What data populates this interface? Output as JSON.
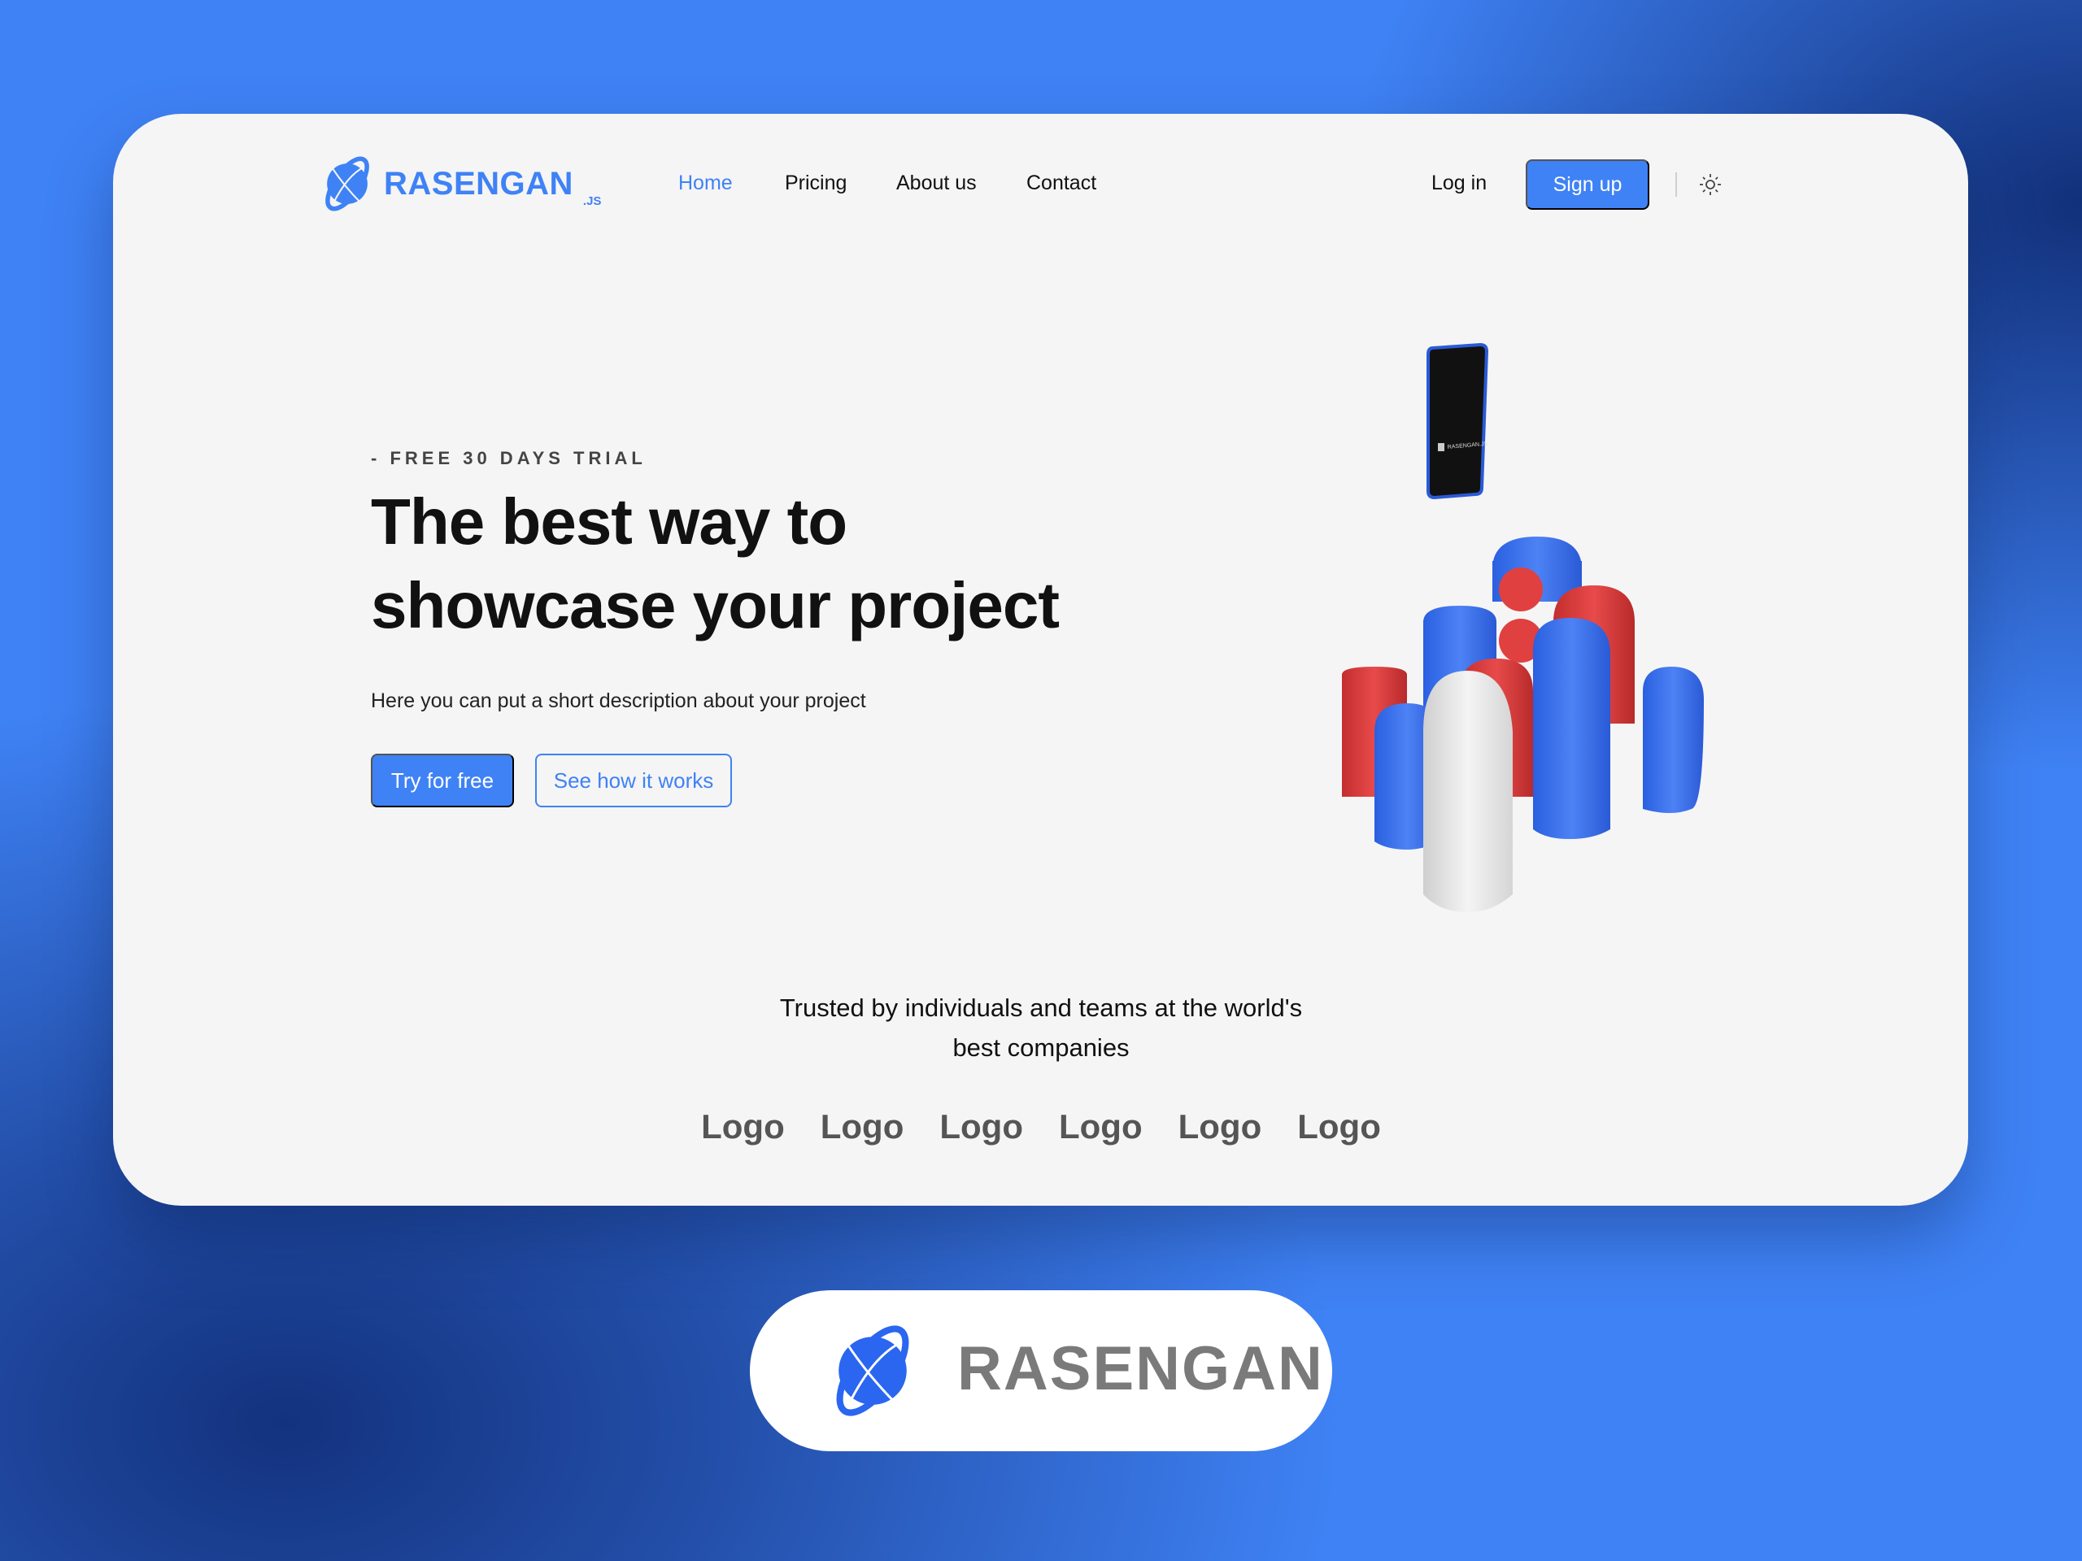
{
  "brand": {
    "name": "RASENGAN",
    "suffix": ".JS",
    "color": "#3f82f5"
  },
  "nav": {
    "items": [
      {
        "label": "Home",
        "active": true
      },
      {
        "label": "Pricing"
      },
      {
        "label": "About us"
      },
      {
        "label": "Contact"
      }
    ],
    "login": "Log in",
    "signup": "Sign up",
    "theme_icon": "sun-icon"
  },
  "hero": {
    "kicker": "- FREE 30 DAYS TRIAL",
    "title_line1": "The best way to",
    "title_line2": "showcase your project",
    "description": "Here you can put a short description about your project",
    "primary_button": "Try for free",
    "secondary_button": "See how it works",
    "phone_label": "RASENGAN.JS"
  },
  "trusted": {
    "line1": "Trusted by individuals and teams at the world's",
    "line2": "best companies",
    "logos": [
      "Logo",
      "Logo",
      "Logo",
      "Logo",
      "Logo",
      "Logo"
    ]
  },
  "footer_badge": {
    "name": "RASENGAN"
  }
}
